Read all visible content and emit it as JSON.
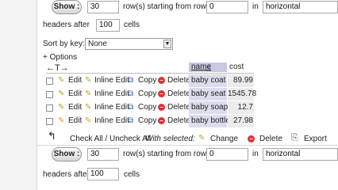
{
  "nav_top": {
    "show_label": "Show :",
    "rows_value": "30",
    "rows_text": "row(s) starting from row #",
    "start_value": "0",
    "in_text": "in",
    "mode_value": "horizontal",
    "headers_after_text": "headers after",
    "headers_value": "100",
    "cells_text": "cells"
  },
  "sort": {
    "label": "Sort by key:",
    "value": "None"
  },
  "options_label": "+ Options",
  "columns_header": {
    "arrows": "←T→",
    "name": "name",
    "cost": "cost"
  },
  "row_actions": {
    "edit": "Edit",
    "inline_edit": "Inline Edit",
    "copy": "Copy",
    "delete": "Delete"
  },
  "rows": [
    {
      "name": "baby coat",
      "cost": "89.99"
    },
    {
      "name": "baby seat",
      "cost": "1545.78"
    },
    {
      "name": "baby soap",
      "cost": "12.7"
    },
    {
      "name": "baby bottle",
      "cost": "27.98"
    }
  ],
  "bulk": {
    "check_all": "Check All / Uncheck All",
    "with_selected": "With selected:",
    "change": "Change",
    "delete": "Delete",
    "export": "Export"
  },
  "nav_bottom": {
    "show_label": "Show :",
    "rows_value": "30",
    "rows_text": "row(s) starting from row #",
    "start_value": "0",
    "in_text": "in",
    "mode_value": "horizontal",
    "headers_after_text": "headers after",
    "headers_value": "100",
    "cells_text": "cells"
  },
  "colors": {
    "name_cell_bg": "#dcdcec",
    "cost_cell_bg": "#ececec",
    "delete_icon": "#dd3333"
  }
}
